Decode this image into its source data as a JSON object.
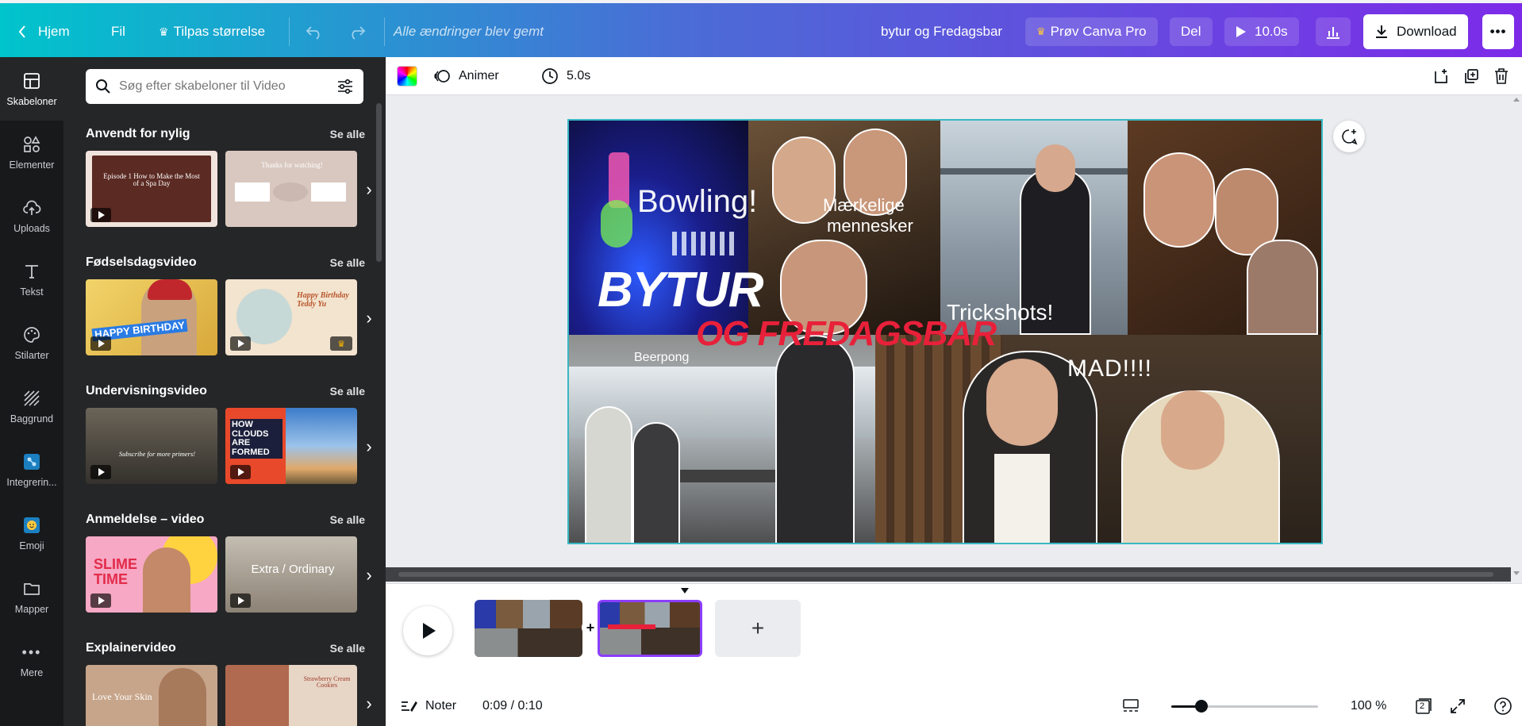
{
  "topbar": {
    "home": "Hjem",
    "file": "Fil",
    "resize": "Tilpas størrelse",
    "saved_status": "Alle ændringer blev gemt",
    "project_title": "bytur og Fredagsbar",
    "try_pro": "Prøv Canva Pro",
    "share": "Del",
    "duration": "10.0s",
    "download": "Download"
  },
  "rail": {
    "items": [
      {
        "label": "Skabeloner",
        "icon": "layout-icon"
      },
      {
        "label": "Elementer",
        "icon": "shapes-icon"
      },
      {
        "label": "Uploads",
        "icon": "cloud-upload-icon"
      },
      {
        "label": "Tekst",
        "icon": "text-icon"
      },
      {
        "label": "Stilarter",
        "icon": "palette-icon"
      },
      {
        "label": "Baggrund",
        "icon": "background-icon"
      },
      {
        "label": "Integrerin...",
        "icon": "integrations-icon"
      },
      {
        "label": "Emoji",
        "icon": "emoji-icon"
      },
      {
        "label": "Mapper",
        "icon": "folder-icon"
      },
      {
        "label": "Mere",
        "icon": "more-icon"
      }
    ]
  },
  "panel": {
    "search_placeholder": "Søg efter skabeloner til Video",
    "see_all": "Se alle",
    "sections": [
      {
        "title": "Anvendt for nylig",
        "thumbs": [
          {
            "text": "Episode 1 How to Make the Most of a Spa Day",
            "bg": "#5b2a22"
          },
          {
            "text": "Thanks for watching!",
            "bg": "#d9c8c0"
          }
        ]
      },
      {
        "title": "Fødselsdagsvideo",
        "thumbs": [
          {
            "text": "HAPPY BIRTHDAY",
            "bg": "#e8c64a"
          },
          {
            "text": "Happy Birthday Teddy Yu",
            "bg": "#f3e4cf"
          }
        ]
      },
      {
        "title": "Undervisningsvideo",
        "thumbs": [
          {
            "text": "Subscribe for more primers!",
            "bg": "#4d4a44"
          },
          {
            "text": "HOW CLOUDS ARE FORMED",
            "bg": "#5a8ac6"
          }
        ]
      },
      {
        "title": "Anmeldelse – video",
        "thumbs": [
          {
            "text": "SLIME TIME",
            "bg": "#f6a8c4"
          },
          {
            "text": "Extra / Ordinary",
            "bg": "#a79e90"
          }
        ]
      },
      {
        "title": "Explainervideo",
        "thumbs": [
          {
            "text": "Love Your Skin",
            "bg": "#c7a58a"
          },
          {
            "text": "Strawberry Cream Cookies",
            "bg": "#e7d5c5"
          }
        ]
      }
    ]
  },
  "context_bar": {
    "animate": "Animer",
    "duration": "5.0s"
  },
  "canvas": {
    "bowling": "Bowling!",
    "strange_people_1": "Mærkelige",
    "strange_people_2": "mennesker",
    "title_main": "BYTUR",
    "title_sub": "OG FREDAGSBAR",
    "trickshots": "Trickshots!",
    "beerpong": "Beerpong",
    "food": "MAD!!!!"
  },
  "timeline": {
    "notes": "Noter",
    "time": "0:09 / 0:10",
    "zoom": "100 %",
    "page_count": "2"
  },
  "colors": {
    "accent": "#8b3dff",
    "selection": "#39b8c2",
    "title_red": "#e8203a",
    "panel_bg": "#252627",
    "rail_bg": "#18191b"
  }
}
